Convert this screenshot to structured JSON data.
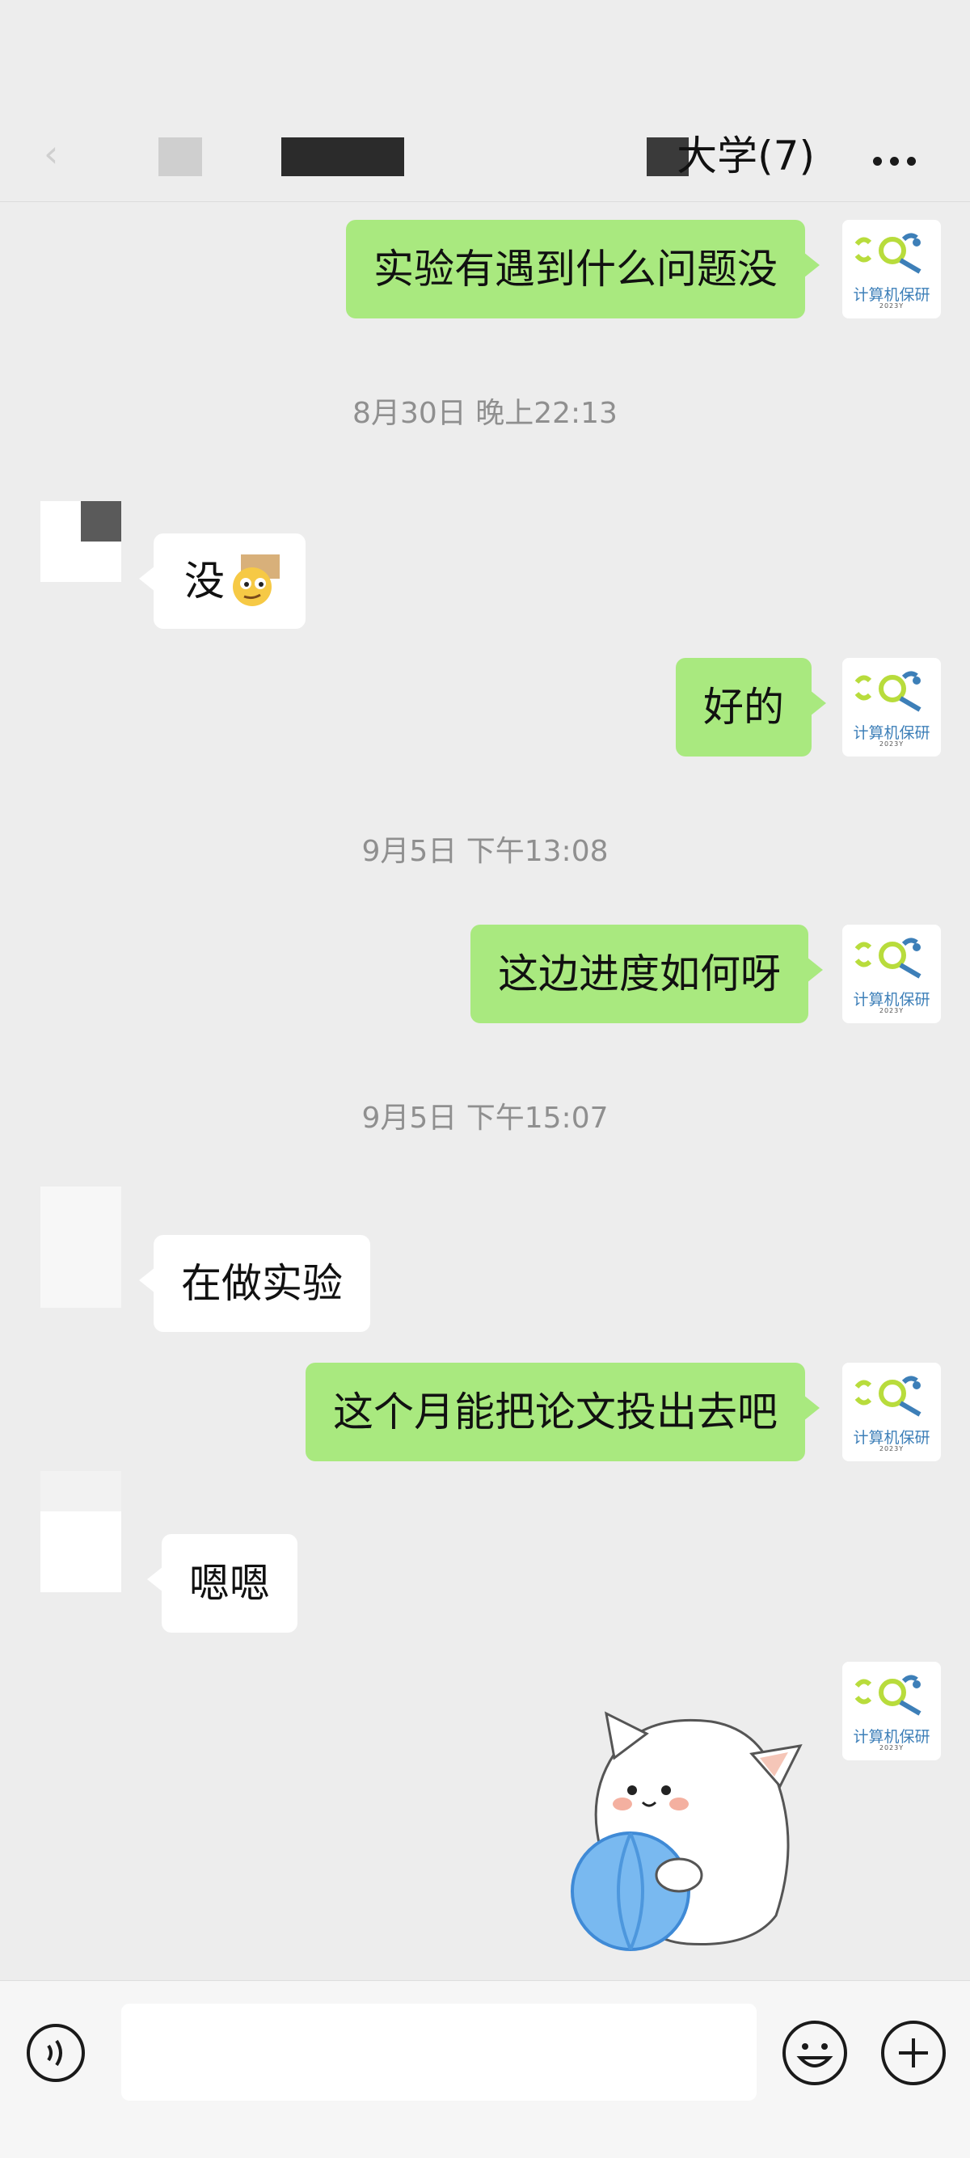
{
  "header": {
    "title": "大学(7)",
    "back_icon": "chevron-left-icon",
    "more_icon": "more-dots-icon"
  },
  "messages": [
    {
      "side": "out",
      "text": "实验有遇到什么问题没"
    },
    {
      "type": "time",
      "text": "8月30日 晚上22:13"
    },
    {
      "side": "in",
      "text": "没"
    },
    {
      "side": "out",
      "text": "好的"
    },
    {
      "type": "time",
      "text": "9月5日 下午13:08"
    },
    {
      "side": "out",
      "text": "这边进度如何呀"
    },
    {
      "type": "time",
      "text": "9月5日 下午15:07"
    },
    {
      "side": "in",
      "text": "在做实验"
    },
    {
      "side": "out",
      "text": "这个月能把论文投出去吧"
    },
    {
      "side": "in",
      "text": "嗯嗯"
    },
    {
      "side": "out",
      "type": "sticker",
      "sticker": "white-cat-with-blue-ball-sticker"
    }
  ],
  "avatar_me": {
    "label": "计算机保研",
    "sub": "2023Y"
  },
  "input_bar": {
    "voice_icon": "voice-icon",
    "emoji_icon": "emoji-icon",
    "plus_icon": "plus-icon",
    "input_value": ""
  },
  "colors": {
    "background": "#ededed",
    "bubble_out": "#a9e97f",
    "bubble_in": "#ffffff",
    "timestamp": "#8f8f8f",
    "logo_blue": "#3d7fb8",
    "logo_green": "#b8dc3c"
  }
}
